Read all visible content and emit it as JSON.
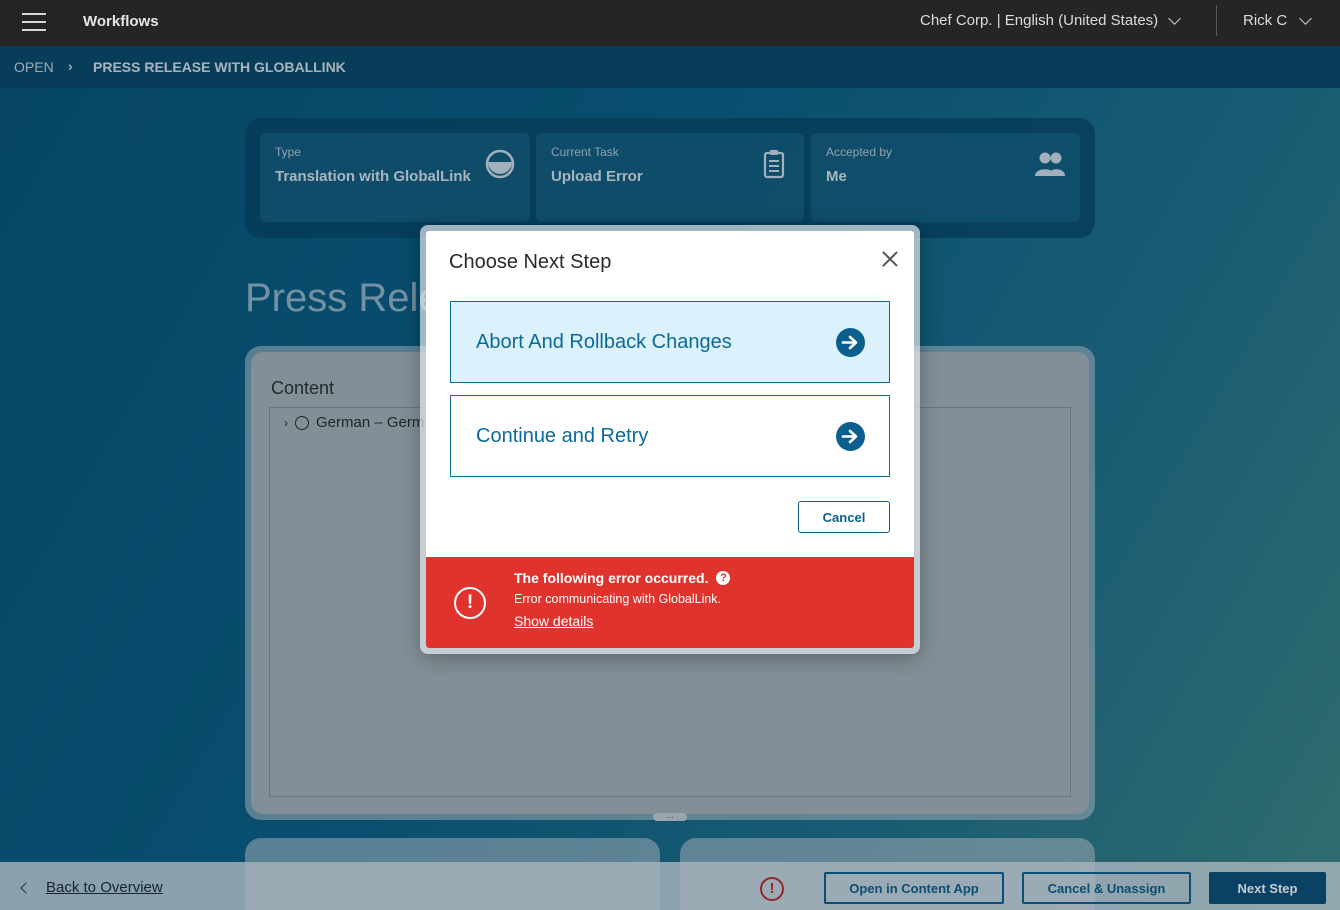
{
  "topbar": {
    "title": "Workflows",
    "site_selector": "Chef Corp. | English (United States)",
    "user": "Rick C"
  },
  "breadcrumb": {
    "root": "OPEN",
    "separator": "›",
    "current": "PRESS RELEASE WITH GLOBALLINK"
  },
  "info_cards": [
    {
      "label": "Type",
      "value": "Translation with GlobalLink",
      "icon": "half-circle-icon"
    },
    {
      "label": "Current Task",
      "value": "Upload Error",
      "icon": "clipboard-icon"
    },
    {
      "label": "Accepted by",
      "value": "Me",
      "icon": "users-icon"
    }
  ],
  "page_heading": "Press Rele",
  "content": {
    "title": "Content",
    "tree_item": "German – Germ"
  },
  "modal": {
    "title": "Choose Next Step",
    "options": [
      {
        "label": "Abort And Rollback Changes",
        "selected": true
      },
      {
        "label": "Continue and Retry",
        "selected": false
      }
    ],
    "cancel_label": "Cancel",
    "error": {
      "title": "The following error occurred.",
      "help": "?",
      "message": "Error communicating with GlobalLink.",
      "details_link": "Show details",
      "icon": "!"
    }
  },
  "footer": {
    "back_label": "Back to Overview",
    "error_icon": "!",
    "open_in_content_app": "Open in Content App",
    "cancel_unassign": "Cancel & Unassign",
    "next_step": "Next Step"
  },
  "colors": {
    "accent": "#0b5f8f",
    "error": "#e0332d",
    "topbar": "#252525"
  }
}
